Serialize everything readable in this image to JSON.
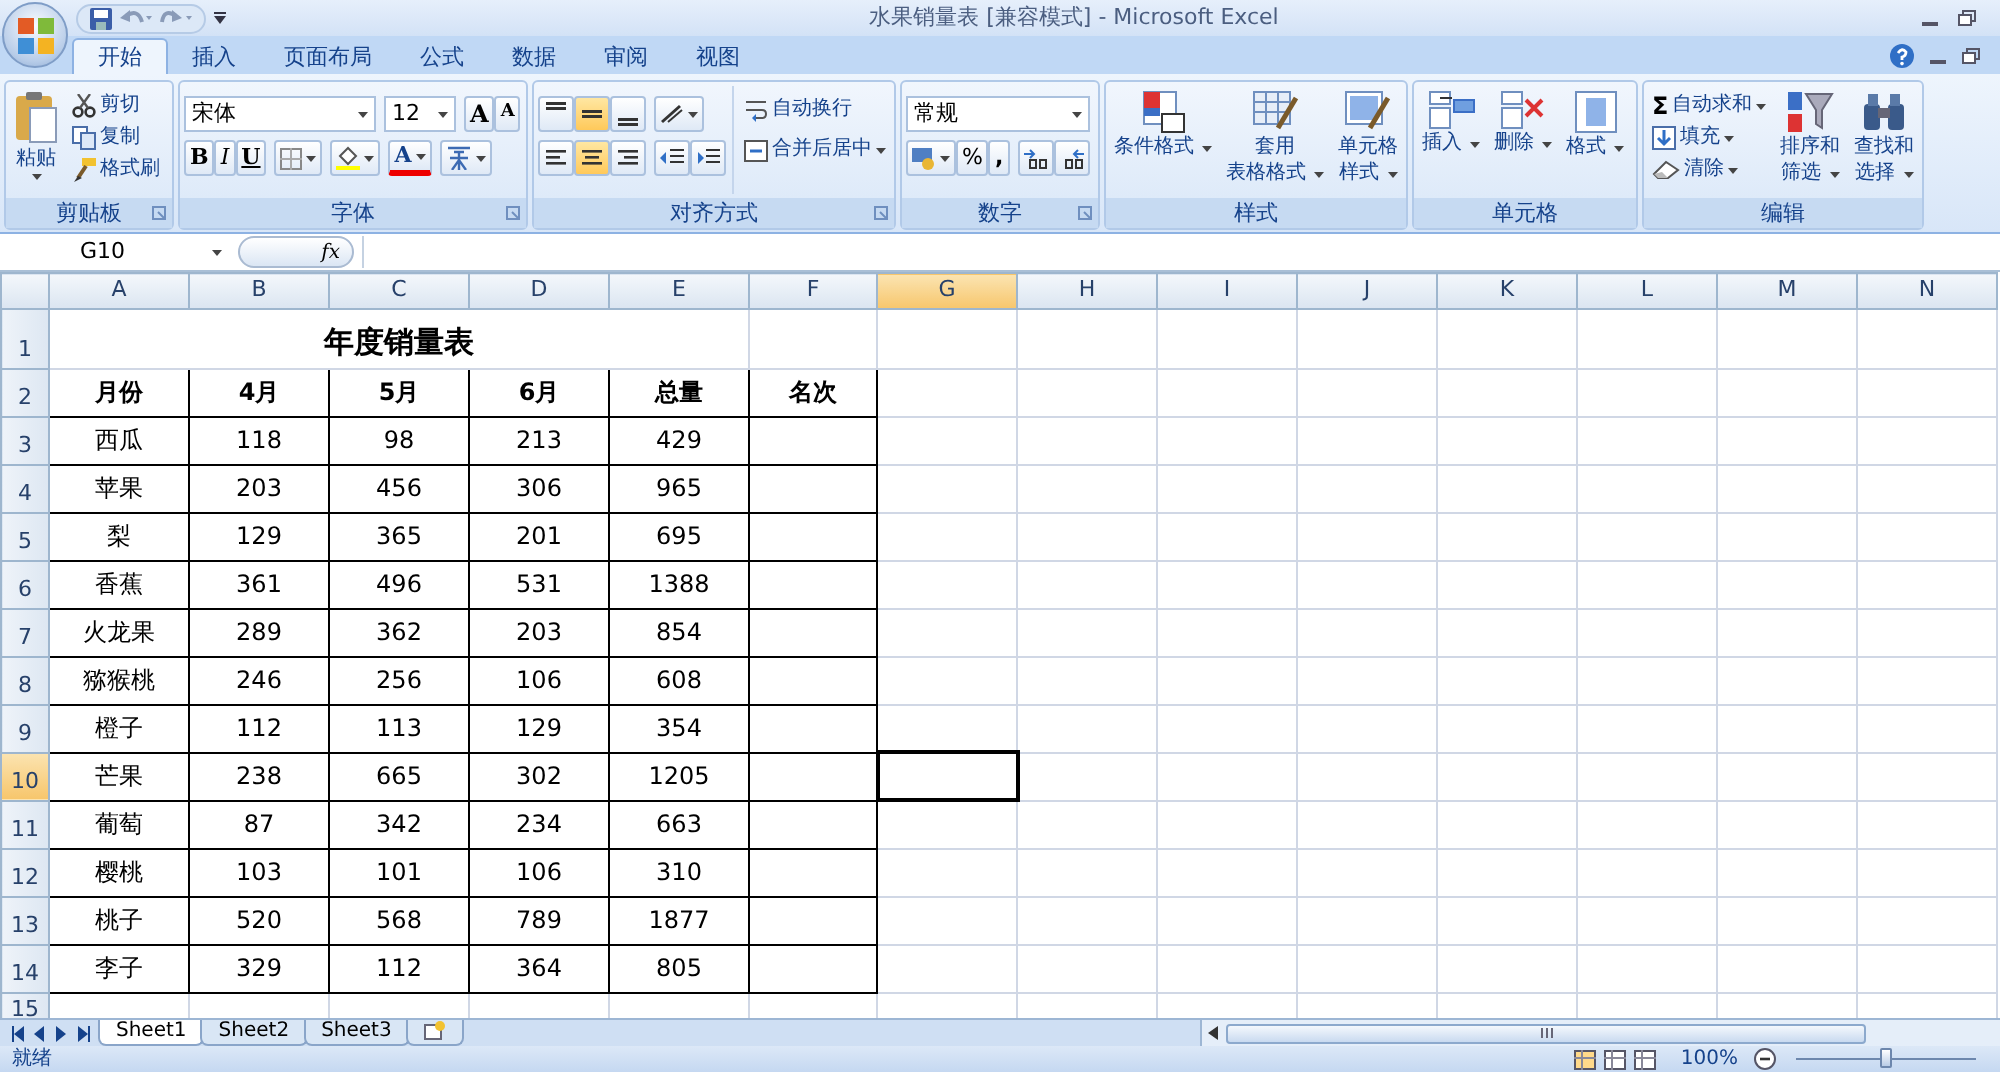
{
  "window": {
    "title": "水果销量表  [兼容模式] - Microsoft Excel"
  },
  "tabs": [
    {
      "label": "开始",
      "selected": true
    },
    {
      "label": "插入",
      "selected": false
    },
    {
      "label": "页面布局",
      "selected": false
    },
    {
      "label": "公式",
      "selected": false
    },
    {
      "label": "数据",
      "selected": false
    },
    {
      "label": "审阅",
      "selected": false
    },
    {
      "label": "视图",
      "selected": false
    }
  ],
  "ribbon": {
    "clipboard": {
      "label": "剪贴板",
      "paste": "粘贴",
      "actions": [
        {
          "kind": "cut",
          "label": "剪切"
        },
        {
          "kind": "copy",
          "label": "复制"
        },
        {
          "kind": "painter",
          "label": "格式刷"
        }
      ]
    },
    "font": {
      "label": "字体",
      "font_name": "宋体",
      "font_size": "12",
      "size_buttons": [
        "A",
        "A"
      ],
      "style_buttons": [
        {
          "kind": "bold",
          "label": "B"
        },
        {
          "kind": "italic",
          "label": "I"
        },
        {
          "kind": "underline",
          "label": "U"
        }
      ],
      "font_color": "A"
    },
    "alignment": {
      "label": "对齐方式",
      "vertical": [
        {
          "selected": false
        },
        {
          "selected": true
        },
        {
          "selected": false
        }
      ],
      "horizontal": [
        {
          "selected": false
        },
        {
          "selected": true
        },
        {
          "selected": false
        }
      ],
      "wrap_text": "自动换行",
      "merge": "合并后居中"
    },
    "number": {
      "label": "数字",
      "format": "常规",
      "percent": "%",
      "comma": ","
    },
    "styles": {
      "label": "样式",
      "buttons": [
        {
          "kind": "conditional",
          "lines": [
            "条件格式"
          ]
        },
        {
          "kind": "table",
          "lines": [
            "套用",
            "表格格式"
          ]
        },
        {
          "kind": "cell",
          "lines": [
            "单元格",
            "样式"
          ]
        }
      ]
    },
    "cells": {
      "label": "单元格",
      "buttons": [
        {
          "kind": "insert",
          "lines": [
            "插入"
          ]
        },
        {
          "kind": "delete",
          "lines": [
            "删除"
          ]
        },
        {
          "kind": "format",
          "lines": [
            "格式"
          ]
        }
      ]
    },
    "editing": {
      "label": "编辑",
      "actions": [
        {
          "kind": "sum",
          "icon": "Σ",
          "label": "自动求和"
        },
        {
          "kind": "fill",
          "label": "填充"
        },
        {
          "kind": "clear",
          "label": "清除"
        }
      ],
      "buttons": [
        {
          "kind": "sort",
          "lines": [
            "排序和",
            "筛选"
          ]
        },
        {
          "kind": "find",
          "lines": [
            "查找和",
            "选择"
          ]
        }
      ]
    }
  },
  "formula_bar": {
    "name_box": "G10",
    "function_label": "fx"
  },
  "sheet": {
    "columns": [
      {
        "label": "A",
        "selected": false
      },
      {
        "label": "B",
        "selected": false
      },
      {
        "label": "C",
        "selected": false
      },
      {
        "label": "D",
        "selected": false
      },
      {
        "label": "E",
        "selected": false
      },
      {
        "label": "F",
        "selected": false
      },
      {
        "label": "G",
        "selected": true
      },
      {
        "label": "H",
        "selected": false
      },
      {
        "label": "I",
        "selected": false
      },
      {
        "label": "J",
        "selected": false
      },
      {
        "label": "K",
        "selected": false
      },
      {
        "label": "L",
        "selected": false
      },
      {
        "label": "M",
        "selected": false
      },
      {
        "label": "N",
        "selected": false
      }
    ],
    "rows": [
      {
        "label": "1",
        "selected": false,
        "kind": "title",
        "cells": [
          "年度销量表"
        ]
      },
      {
        "label": "2",
        "selected": false,
        "kind": "header",
        "cells": [
          "月份",
          "4月",
          "5月",
          "6月",
          "总量",
          "名次"
        ]
      },
      {
        "label": "3",
        "selected": false,
        "kind": "data",
        "cells": [
          "西瓜",
          "118",
          "98",
          "213",
          "429"
        ]
      },
      {
        "label": "4",
        "selected": false,
        "kind": "data",
        "cells": [
          "苹果",
          "203",
          "456",
          "306",
          "965"
        ]
      },
      {
        "label": "5",
        "selected": false,
        "kind": "data",
        "cells": [
          "梨",
          "129",
          "365",
          "201",
          "695"
        ]
      },
      {
        "label": "6",
        "selected": false,
        "kind": "data",
        "cells": [
          "香蕉",
          "361",
          "496",
          "531",
          "1388"
        ]
      },
      {
        "label": "7",
        "selected": false,
        "kind": "data",
        "cells": [
          "火龙果",
          "289",
          "362",
          "203",
          "854"
        ]
      },
      {
        "label": "8",
        "selected": false,
        "kind": "data",
        "cells": [
          "猕猴桃",
          "246",
          "256",
          "106",
          "608"
        ]
      },
      {
        "label": "9",
        "selected": false,
        "kind": "data",
        "cells": [
          "橙子",
          "112",
          "113",
          "129",
          "354"
        ]
      },
      {
        "label": "10",
        "selected": true,
        "kind": "data",
        "cells": [
          "芒果",
          "238",
          "665",
          "302",
          "1205"
        ]
      },
      {
        "label": "11",
        "selected": false,
        "kind": "data",
        "cells": [
          "葡萄",
          "87",
          "342",
          "234",
          "663"
        ]
      },
      {
        "label": "12",
        "selected": false,
        "kind": "data",
        "cells": [
          "樱桃",
          "103",
          "101",
          "106",
          "310"
        ]
      },
      {
        "label": "13",
        "selected": false,
        "kind": "data",
        "cells": [
          "桃子",
          "520",
          "568",
          "789",
          "1877"
        ]
      },
      {
        "label": "14",
        "selected": false,
        "kind": "data",
        "cells": [
          "李子",
          "329",
          "112",
          "364",
          "805"
        ]
      },
      {
        "label": "15",
        "selected": false,
        "kind": "blank"
      }
    ]
  },
  "sheet_tabs": [
    {
      "label": "Sheet1",
      "selected": true
    },
    {
      "label": "Sheet2",
      "selected": false
    },
    {
      "label": "Sheet3",
      "selected": false
    }
  ],
  "status_bar": {
    "status": "就绪",
    "zoom": "100%",
    "zoom_slider": {
      "level": 0.5
    }
  }
}
